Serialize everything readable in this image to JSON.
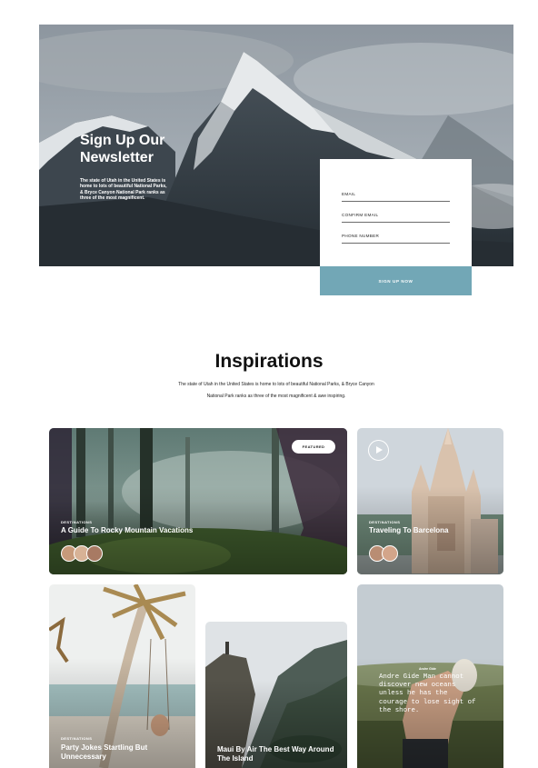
{
  "newsletter": {
    "title": "Sign Up Our Newsletter",
    "description": "The state of Utah in the United States is home to lots of beautiful National Parks, & Bryce Canyon National Park ranks as three of the most magnificent.",
    "fields": [
      {
        "label": "EMAIL",
        "value": ""
      },
      {
        "label": "CONFIRM EMAIL",
        "value": ""
      },
      {
        "label": "PHONE NUMBER",
        "value": ""
      }
    ],
    "submit_label": "SIGN UP NOW",
    "button_color": "#72a7b6"
  },
  "inspirations": {
    "title": "Inspirations",
    "subtitle": "The state of Utah in the United States is home to lots of beautiful National Parks, & Bryce Canyon National Park ranks as three of the most magnificent & awe inspiring.",
    "cards": [
      {
        "category": "DESTINATIONS",
        "title": "A Guide To Rocky Mountain Vacations",
        "badge": "FEATURED",
        "image": "forest",
        "avatars": 3
      },
      {
        "category": "DESTINATIONS",
        "title": "Traveling To Barcelona",
        "image": "cathedral",
        "avatars": 2,
        "icon": "play-icon"
      },
      {
        "category": "DESTINATIONS",
        "title": "Party Jokes Startling But Unnecessary",
        "image": "palm-swing"
      },
      {
        "title": "Maui By Air The Best Way Around The Island",
        "image": "valley-cliff"
      },
      {
        "author": "Andre Gide",
        "quote": "Andre Gide Man cannot discover new oceans unless he has the courage to lose sight of the shore.",
        "image": "hand-mug"
      }
    ]
  }
}
